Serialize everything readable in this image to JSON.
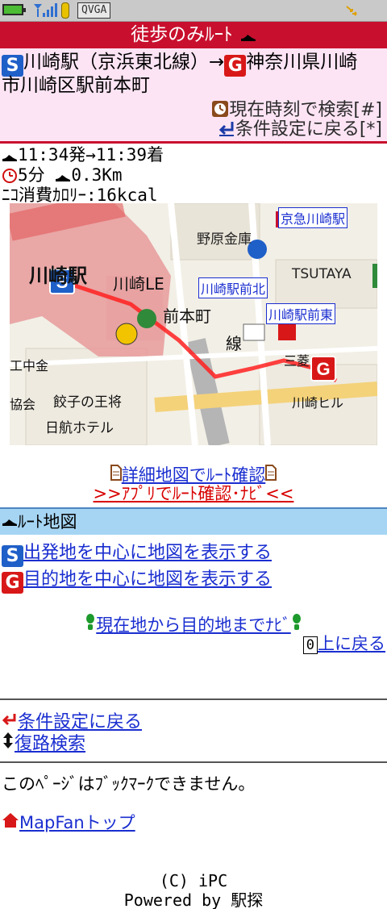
{
  "status_bar": {
    "mode_label": "QVGA",
    "icons": [
      "battery-icon",
      "signal-icon",
      "memory-card-icon",
      "qvga-icon",
      "gps-icon"
    ]
  },
  "header": {
    "title": "徒歩のみﾙｰﾄ"
  },
  "route": {
    "start_badge": "S",
    "goal_badge": "G",
    "from": "川崎駅（京浜東北線）→",
    "to_line1": "神奈川県川崎",
    "to_line2": "市川崎区駅前本町",
    "search_now": "現在時刻で検索[#]",
    "back_conditions": "条件設定に戻る[*]"
  },
  "summary": {
    "time": "11:34発→11:39着",
    "duration": "5分",
    "distance": "0.3Km",
    "calorie_label": "ﾆｺ",
    "calorie": "消費ｶﾛﾘｰ:16kcal"
  },
  "map_labels": {
    "kawasaki": "川崎駅",
    "keikyu": "京急川崎駅",
    "nopporo": "野原金庫",
    "tsutaya": "TSUTAYA",
    "mae_kita": "川崎駅前北",
    "mae_higashi": "川崎駅前東",
    "honmachi": "前本町",
    "kawasaki_hill": "川崎ヒル",
    "gyoza": "餃子の王将",
    "nikko": "日航ホテル",
    "kyokai": "協会",
    "jigyo": "工中金",
    "sen": "線",
    "le": "川崎LE",
    "kinbi": "三菱"
  },
  "links": {
    "detail_map": "詳細地図でﾙｰﾄ確認",
    "app_navi": ">>ｱﾌﾟﾘでﾙｰﾄ確認･ﾅﾋﾞ<<",
    "route_map_section": "ﾙｰﾄ地図",
    "start_center": "出発地を中心に地図を表示する",
    "goal_center": "目的地を中心に地図を表示する",
    "navi_current": "現在地から目的地までﾅﾋﾞ",
    "top_key": "0",
    "back_top": "上に戻る",
    "back_conditions": "条件設定に戻る",
    "return_route": "復路検索",
    "no_bookmark": "このﾍﾟｰｼﾞはﾌﾞｯｸﾏｰｸできません。",
    "mapfan_top": "MapFanトップ"
  },
  "footer": {
    "copyright": "(C) iPC",
    "powered": "Powered by 駅探"
  },
  "colors": {
    "brand_red": "#c8102e",
    "link_blue": "#1a2ed0",
    "start_blue": "#1f5fc8",
    "goal_red": "#d81818",
    "route_bg": "#fce4f4",
    "section_blue": "#a6d5f3"
  }
}
